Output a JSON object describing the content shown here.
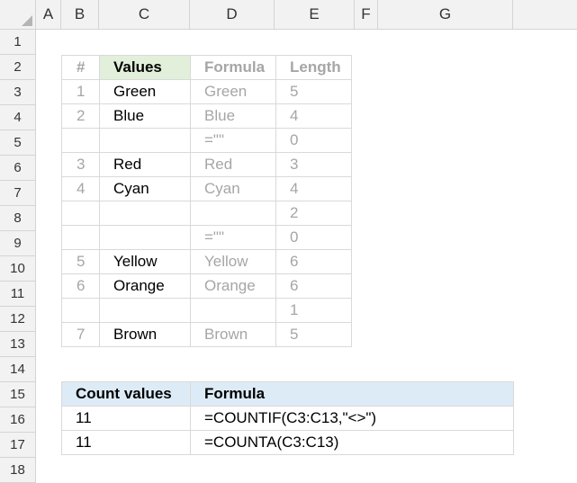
{
  "columns": [
    "A",
    "B",
    "C",
    "D",
    "E",
    "F",
    "G"
  ],
  "rows": [
    "1",
    "2",
    "3",
    "4",
    "5",
    "6",
    "7",
    "8",
    "9",
    "10",
    "11",
    "12",
    "13",
    "14",
    "15",
    "16",
    "17",
    "18"
  ],
  "values_table": {
    "headers": {
      "num": "#",
      "values": "Values",
      "formula": "Formula",
      "length": "Length"
    },
    "rows": [
      {
        "num": "1",
        "value": "Green",
        "formula": "Green",
        "length": "5"
      },
      {
        "num": "2",
        "value": "Blue",
        "formula": "Blue",
        "length": "4"
      },
      {
        "num": "",
        "value": "",
        "formula": "=\"\"",
        "length": "0"
      },
      {
        "num": "3",
        "value": "Red",
        "formula": "Red",
        "length": "3"
      },
      {
        "num": "4",
        "value": "Cyan",
        "formula": "Cyan",
        "length": "4"
      },
      {
        "num": "",
        "value": "",
        "formula": "",
        "length": "2"
      },
      {
        "num": "",
        "value": "",
        "formula": "=\"\"",
        "length": "0"
      },
      {
        "num": "5",
        "value": "Yellow",
        "formula": "Yellow",
        "length": "6"
      },
      {
        "num": "6",
        "value": "Orange",
        "formula": "Orange",
        "length": "6"
      },
      {
        "num": "",
        "value": "",
        "formula": "",
        "length": "1"
      },
      {
        "num": "7",
        "value": "Brown",
        "formula": "Brown",
        "length": "5"
      }
    ]
  },
  "count_table": {
    "headers": {
      "count": "Count values",
      "formula": "Formula"
    },
    "rows": [
      {
        "count": "11",
        "formula": "=COUNTIF(C3:C13,\"<>\")"
      },
      {
        "count": "11",
        "formula": "=COUNTA(C3:C13)"
      }
    ]
  },
  "colors": {
    "values_header_bg": "#e2efda",
    "count_header_bg": "#ddebf7",
    "muted_text": "#a6a6a6"
  }
}
